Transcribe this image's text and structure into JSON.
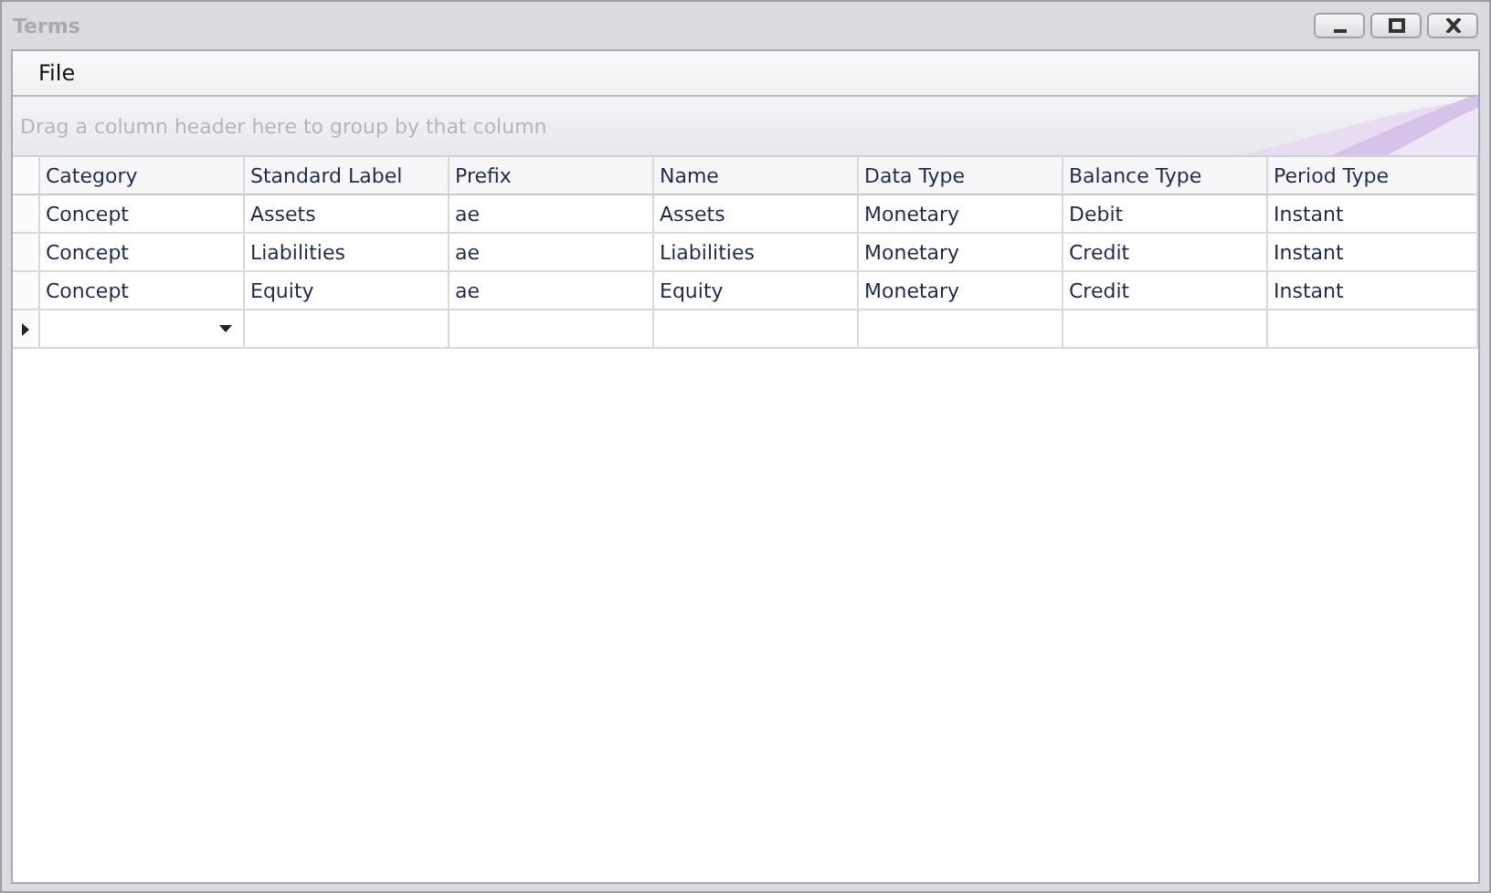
{
  "window": {
    "title": "Terms"
  },
  "menu": [
    "File"
  ],
  "group_panel": {
    "placeholder": "Drag a column header here to group by that column"
  },
  "table": {
    "columns": [
      "Category",
      "Standard Label",
      "Prefix",
      "Name",
      "Data Type",
      "Balance Type",
      "Period Type"
    ],
    "rows": [
      {
        "current": false,
        "cells": [
          "Concept",
          "Assets",
          "ae",
          "Assets",
          "Monetary",
          "Debit",
          "Instant"
        ]
      },
      {
        "current": false,
        "cells": [
          "Concept",
          "Liabilities",
          "ae",
          "Liabilities",
          "Monetary",
          "Credit",
          "Instant"
        ]
      },
      {
        "current": false,
        "cells": [
          "Concept",
          "Equity",
          "ae",
          "Equity",
          "Monetary",
          "Credit",
          "Instant"
        ]
      }
    ],
    "new_row": {
      "current": true
    }
  }
}
